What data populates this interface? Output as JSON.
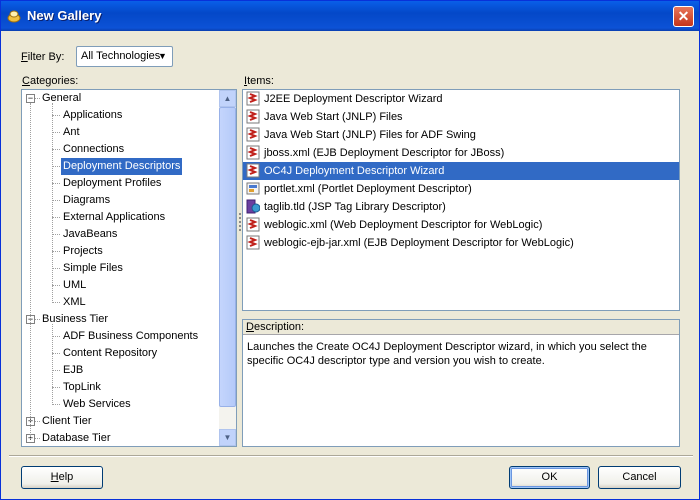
{
  "window": {
    "title": "New Gallery",
    "close_glyph": "✕",
    "accent": "#0a5fe8"
  },
  "filter": {
    "label_prefix": "",
    "label_key": "F",
    "label_rest": "ilter By:",
    "value": "All Technologies",
    "arrow": "▼"
  },
  "categories": {
    "label_key": "C",
    "label_rest": "ategories:",
    "tree": [
      {
        "label": "General",
        "expander": "−"
      },
      {
        "label": "Applications"
      },
      {
        "label": "Ant"
      },
      {
        "label": "Connections"
      },
      {
        "label": "Deployment Descriptors",
        "selected": true
      },
      {
        "label": "Deployment Profiles"
      },
      {
        "label": "Diagrams"
      },
      {
        "label": "External Applications"
      },
      {
        "label": "JavaBeans"
      },
      {
        "label": "Projects"
      },
      {
        "label": "Simple Files"
      },
      {
        "label": "UML"
      },
      {
        "label": "XML"
      },
      {
        "label": "Business Tier",
        "expander": "−"
      },
      {
        "label": "ADF Business Components"
      },
      {
        "label": "Content Repository"
      },
      {
        "label": "EJB"
      },
      {
        "label": "TopLink"
      },
      {
        "label": "Web Services"
      },
      {
        "label": "Client Tier",
        "expander": "+"
      },
      {
        "label": "Database Tier",
        "expander": "+"
      }
    ]
  },
  "items": {
    "label_key": "I",
    "label_rest": "tems:",
    "list": [
      {
        "label": "J2EE Deployment Descriptor Wizard",
        "icon": "wizard-icon"
      },
      {
        "label": "Java Web Start (JNLP) Files",
        "icon": "wizard-icon"
      },
      {
        "label": "Java Web Start (JNLP) Files for ADF Swing",
        "icon": "wizard-icon"
      },
      {
        "label": "jboss.xml (EJB Deployment Descriptor for JBoss)",
        "icon": "wizard-icon"
      },
      {
        "label": "OC4J Deployment Descriptor Wizard",
        "icon": "wizard-icon",
        "selected": true
      },
      {
        "label": "portlet.xml (Portlet Deployment Descriptor)",
        "icon": "portlet-icon"
      },
      {
        "label": "taglib.tld (JSP Tag Library Descriptor)",
        "icon": "taglib-icon"
      },
      {
        "label": "weblogic.xml (Web Deployment Descriptor for WebLogic)",
        "icon": "wizard-icon"
      },
      {
        "label": "weblogic-ejb-jar.xml (EJB Deployment Descriptor for WebLogic)",
        "icon": "wizard-icon"
      }
    ]
  },
  "description": {
    "label_key": "D",
    "label_rest": "escription:",
    "text": "Launches the Create OC4J Deployment Descriptor wizard, in which you select the specific OC4J descriptor type and version you wish to create."
  },
  "buttons": {
    "help_key": "H",
    "help_rest": "elp",
    "ok": "OK",
    "cancel": "Cancel"
  },
  "scroll": {
    "up": "▲",
    "down": "▼"
  }
}
